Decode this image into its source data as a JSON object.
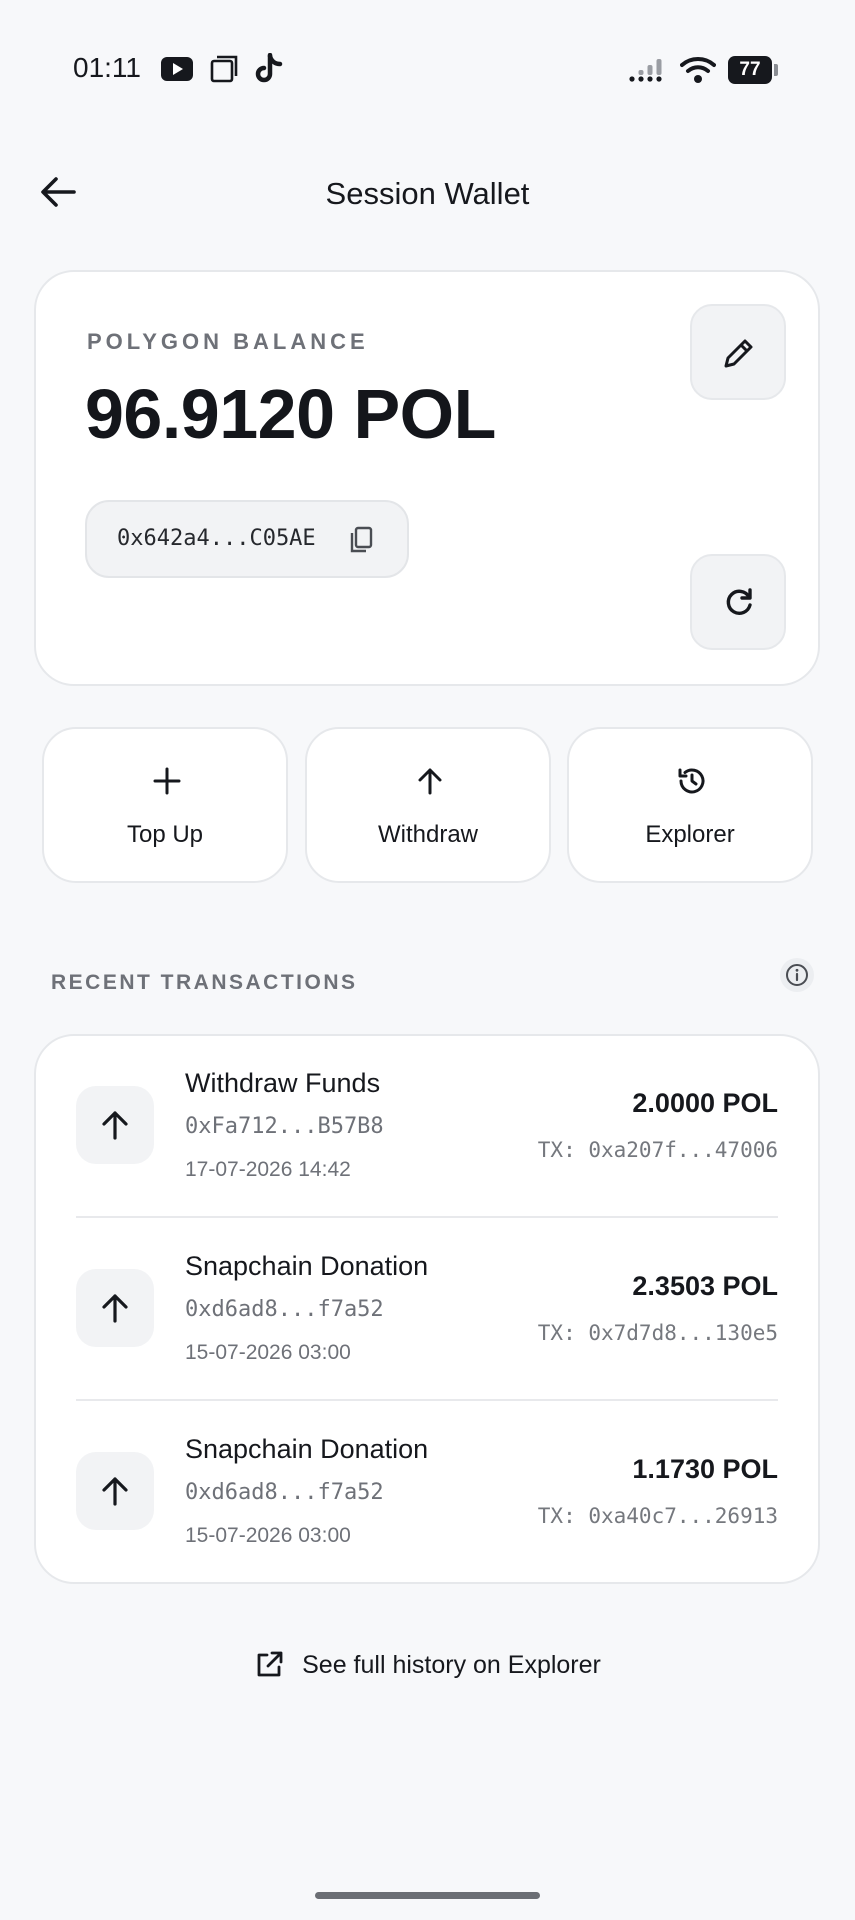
{
  "status_bar": {
    "time": "01:11",
    "battery": "77",
    "icons": [
      "youtube-icon",
      "square-stack-icon",
      "tiktok-icon",
      "signal-icon",
      "wifi-icon",
      "battery-icon"
    ]
  },
  "header": {
    "title": "Session Wallet",
    "back_icon": "arrow-left-icon"
  },
  "balance_card": {
    "label": "POLYGON BALANCE",
    "value": "96.9120 POL",
    "address": "0x642a4...C05AE",
    "copy_icon": "copy-icon",
    "edit_icon": "pencil-icon",
    "refresh_icon": "refresh-icon"
  },
  "actions": [
    {
      "label": "Top Up",
      "icon": "plus-icon"
    },
    {
      "label": "Withdraw",
      "icon": "arrow-up-icon"
    },
    {
      "label": "Explorer",
      "icon": "history-icon"
    }
  ],
  "recent": {
    "title": "RECENT TRANSACTIONS",
    "info_icon": "info-icon",
    "transactions": [
      {
        "title": "Withdraw Funds",
        "address": "0xFa712...B57B8",
        "date": "17-07-2026 14:42",
        "amount": "2.0000 POL",
        "hash": "TX: 0xa207f...47006"
      },
      {
        "title": "Snapchain Donation",
        "address": "0xd6ad8...f7a52",
        "date": "15-07-2026 03:00",
        "amount": "2.3503 POL",
        "hash": "TX: 0x7d7d8...130e5"
      },
      {
        "title": "Snapchain Donation",
        "address": "0xd6ad8...f7a52",
        "date": "15-07-2026 03:00",
        "amount": "1.1730 POL",
        "hash": "TX: 0xa40c7...26913"
      }
    ]
  },
  "footer": {
    "history_link": "See full history on Explorer",
    "link_icon": "external-link-icon"
  },
  "colors": {
    "background": "#f7f8fa",
    "card": "#ffffff",
    "text": "#16181d",
    "muted": "#6e7178"
  }
}
